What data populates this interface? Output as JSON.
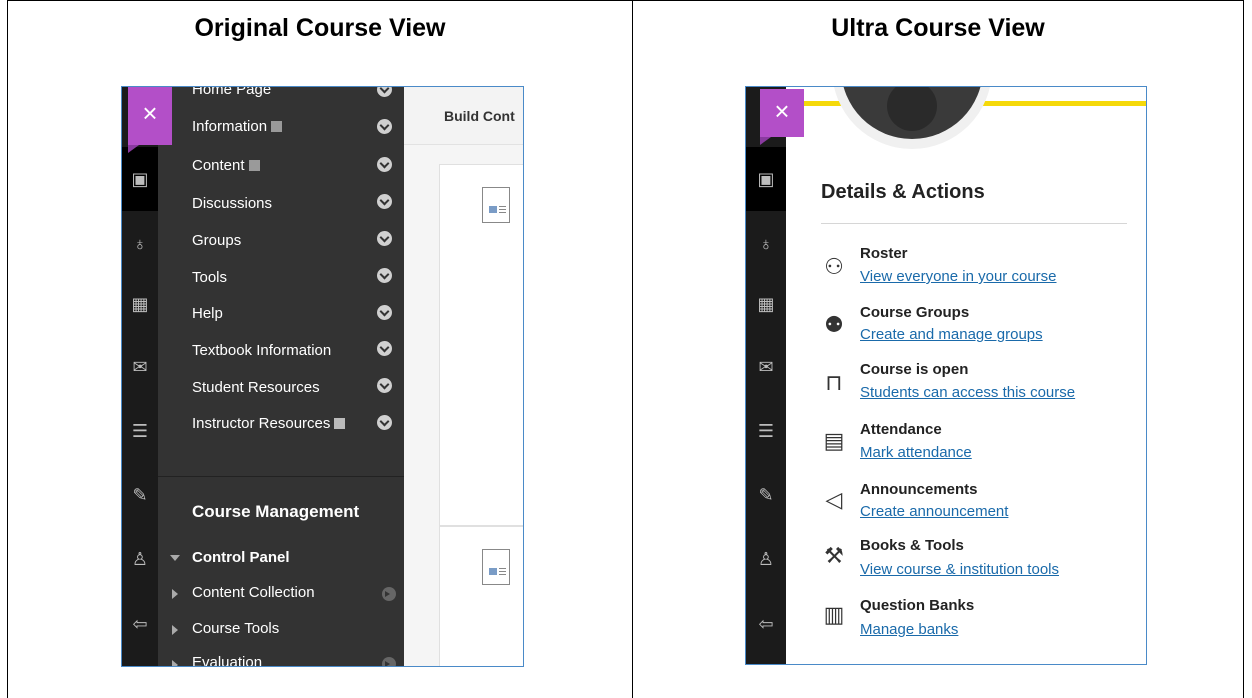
{
  "columns": {
    "left_title": "Original Course View",
    "right_title": "Ultra Course View"
  },
  "original": {
    "close_glyph": "×",
    "content_bar_label": "Build Cont",
    "menu_items": [
      {
        "label": "Home Page"
      },
      {
        "label": "Information"
      },
      {
        "label": "Content"
      },
      {
        "label": "Discussions"
      },
      {
        "label": "Groups"
      },
      {
        "label": "Tools"
      },
      {
        "label": "Help"
      },
      {
        "label": "Textbook Information"
      },
      {
        "label": "Student Resources"
      },
      {
        "label": "Instructor Resources"
      }
    ],
    "course_management": "Course Management",
    "control_panel": "Control Panel",
    "control_items": [
      {
        "label": "Content Collection"
      },
      {
        "label": "Course Tools"
      },
      {
        "label": "Evaluation"
      }
    ]
  },
  "ultra": {
    "close_glyph": "×",
    "section_title": "Details & Actions",
    "rows": [
      {
        "title": "Roster",
        "link": "View everyone in your course",
        "icon": "roster-icon"
      },
      {
        "title": "Course Groups",
        "link": "Create and manage groups",
        "icon": "groups-icon"
      },
      {
        "title": "Course is open",
        "link": "Students can access this course",
        "icon": "unlock-icon"
      },
      {
        "title": "Attendance",
        "link": "Mark attendance",
        "icon": "attendance-icon"
      },
      {
        "title": "Announcements",
        "link": "Create announcement",
        "icon": "megaphone-icon"
      },
      {
        "title": "Books & Tools",
        "link": "View course & institution tools",
        "icon": "wrench-icon"
      },
      {
        "title": "Question Banks",
        "link": "Manage banks",
        "icon": "question-bank-icon"
      }
    ]
  },
  "colors": {
    "close_box": "#b34fc8",
    "menu_bg": "#333333",
    "link": "#1a6aaa",
    "accent_yellow": "#f5d90a"
  }
}
